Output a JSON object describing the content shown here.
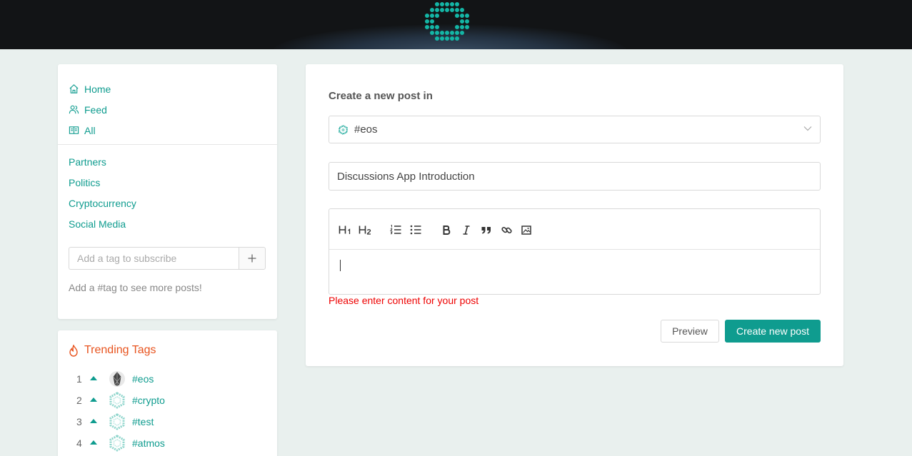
{
  "sidebar": {
    "nav": [
      {
        "label": "Home",
        "icon": "home-icon"
      },
      {
        "label": "Feed",
        "icon": "users-icon"
      },
      {
        "label": "All",
        "icon": "book-icon"
      }
    ],
    "tags": [
      "Partners",
      "Politics",
      "Cryptocurrency",
      "Social Media"
    ],
    "subscribe_placeholder": "Add a tag to subscribe",
    "subscribe_button_icon": "plus-icon",
    "hint": "Add a #tag to see more posts!"
  },
  "trending": {
    "title": "Trending Tags",
    "icon": "fire-icon",
    "items": [
      {
        "rank": "1",
        "tag": "#eos",
        "icon": "eos-logo-icon"
      },
      {
        "rank": "2",
        "tag": "#crypto",
        "icon": "dotted-hexagon-icon"
      },
      {
        "rank": "3",
        "tag": "#test",
        "icon": "dotted-hexagon-icon"
      },
      {
        "rank": "4",
        "tag": "#atmos",
        "icon": "dotted-hexagon-icon"
      }
    ]
  },
  "main": {
    "heading": "Create a new post in",
    "selected_tag": "#eos",
    "title_value": "Discussions App Introduction",
    "toolbar": [
      "heading-1-icon",
      "heading-2-icon",
      "ordered-list-icon",
      "bullet-list-icon",
      "bold-icon",
      "italic-icon",
      "quote-icon",
      "link-icon",
      "image-icon"
    ],
    "error": "Please enter content for your post",
    "preview_label": "Preview",
    "create_label": "Create new post"
  },
  "colors": {
    "accent": "#0f9c8f",
    "trending": "#e8541f",
    "error": "#e00000",
    "background": "#e9f0ee"
  }
}
